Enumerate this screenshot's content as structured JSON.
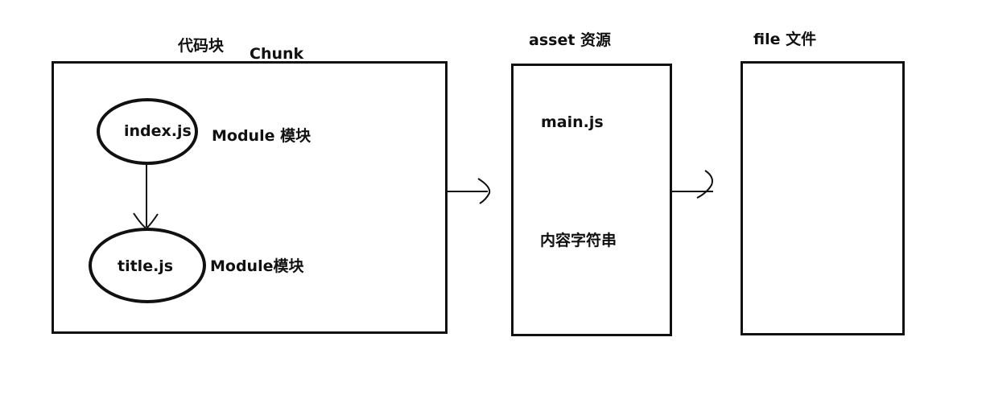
{
  "chunk": {
    "title_cn": "代码块",
    "title_en": "Chunk",
    "modules": [
      {
        "name": "index.js",
        "label": "Module 模块"
      },
      {
        "name": "title.js",
        "label": "Module模块"
      }
    ]
  },
  "asset": {
    "title": "asset 资源",
    "file_name": "main.js",
    "content": "内容字符串"
  },
  "file": {
    "title": "file 文件"
  }
}
